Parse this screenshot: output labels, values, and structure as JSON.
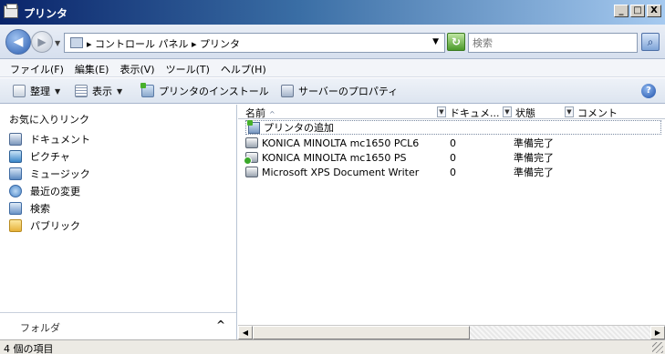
{
  "window": {
    "title": "プリンタ",
    "min_label": "_",
    "max_label": "□",
    "close_label": "X"
  },
  "address": {
    "back_glyph": "◀",
    "forward_glyph": "▶",
    "crumb": "▸ コントロール パネル ▸ プリンタ",
    "refresh_glyph": "↻",
    "search_placeholder": "検索",
    "search_glyph": "⌕"
  },
  "menubar": {
    "items": [
      {
        "label": "ファイル(F)"
      },
      {
        "label": "編集(E)"
      },
      {
        "label": "表示(V)"
      },
      {
        "label": "ツール(T)"
      },
      {
        "label": "ヘルプ(H)"
      }
    ]
  },
  "toolbar": {
    "organize_label": "整理",
    "view_label": "表示",
    "install_label": "プリンタのインストール",
    "server_props_label": "サーバーのプロパティ",
    "help_glyph": "?"
  },
  "navpane": {
    "favorites_header": "お気に入りリンク",
    "items": [
      {
        "label": "ドキュメント",
        "icon": "documents-icon"
      },
      {
        "label": "ピクチャ",
        "icon": "pictures-icon"
      },
      {
        "label": "ミュージック",
        "icon": "music-icon"
      },
      {
        "label": "最近の変更",
        "icon": "recent-changes-icon"
      },
      {
        "label": "検索",
        "icon": "search-folder-icon"
      },
      {
        "label": "パブリック",
        "icon": "public-folder-icon"
      }
    ],
    "folders_label": "フォルダ",
    "folders_chevron": "^"
  },
  "filelist": {
    "columns": {
      "name": "名前",
      "sort_glyph": "^",
      "documents": "ドキュメ...",
      "status": "状態",
      "comment": "コメント"
    },
    "add_printer_label": "プリンタの追加",
    "rows": [
      {
        "name": "KONICA MINOLTA mc1650 PCL6",
        "documents": "0",
        "status": "準備完了",
        "default": false
      },
      {
        "name": "KONICA MINOLTA mc1650 PS",
        "documents": "0",
        "status": "準備完了",
        "default": true
      },
      {
        "name": "Microsoft XPS Document Writer",
        "documents": "0",
        "status": "準備完了",
        "default": false
      }
    ]
  },
  "statusbar": {
    "text": "4 個の項目"
  },
  "colors": {
    "title_gradient_start": "#0a246a",
    "title_gradient_end": "#a6caf0",
    "address_bg": "#e9eef6",
    "default_printer_badge": "#3aa82a"
  }
}
